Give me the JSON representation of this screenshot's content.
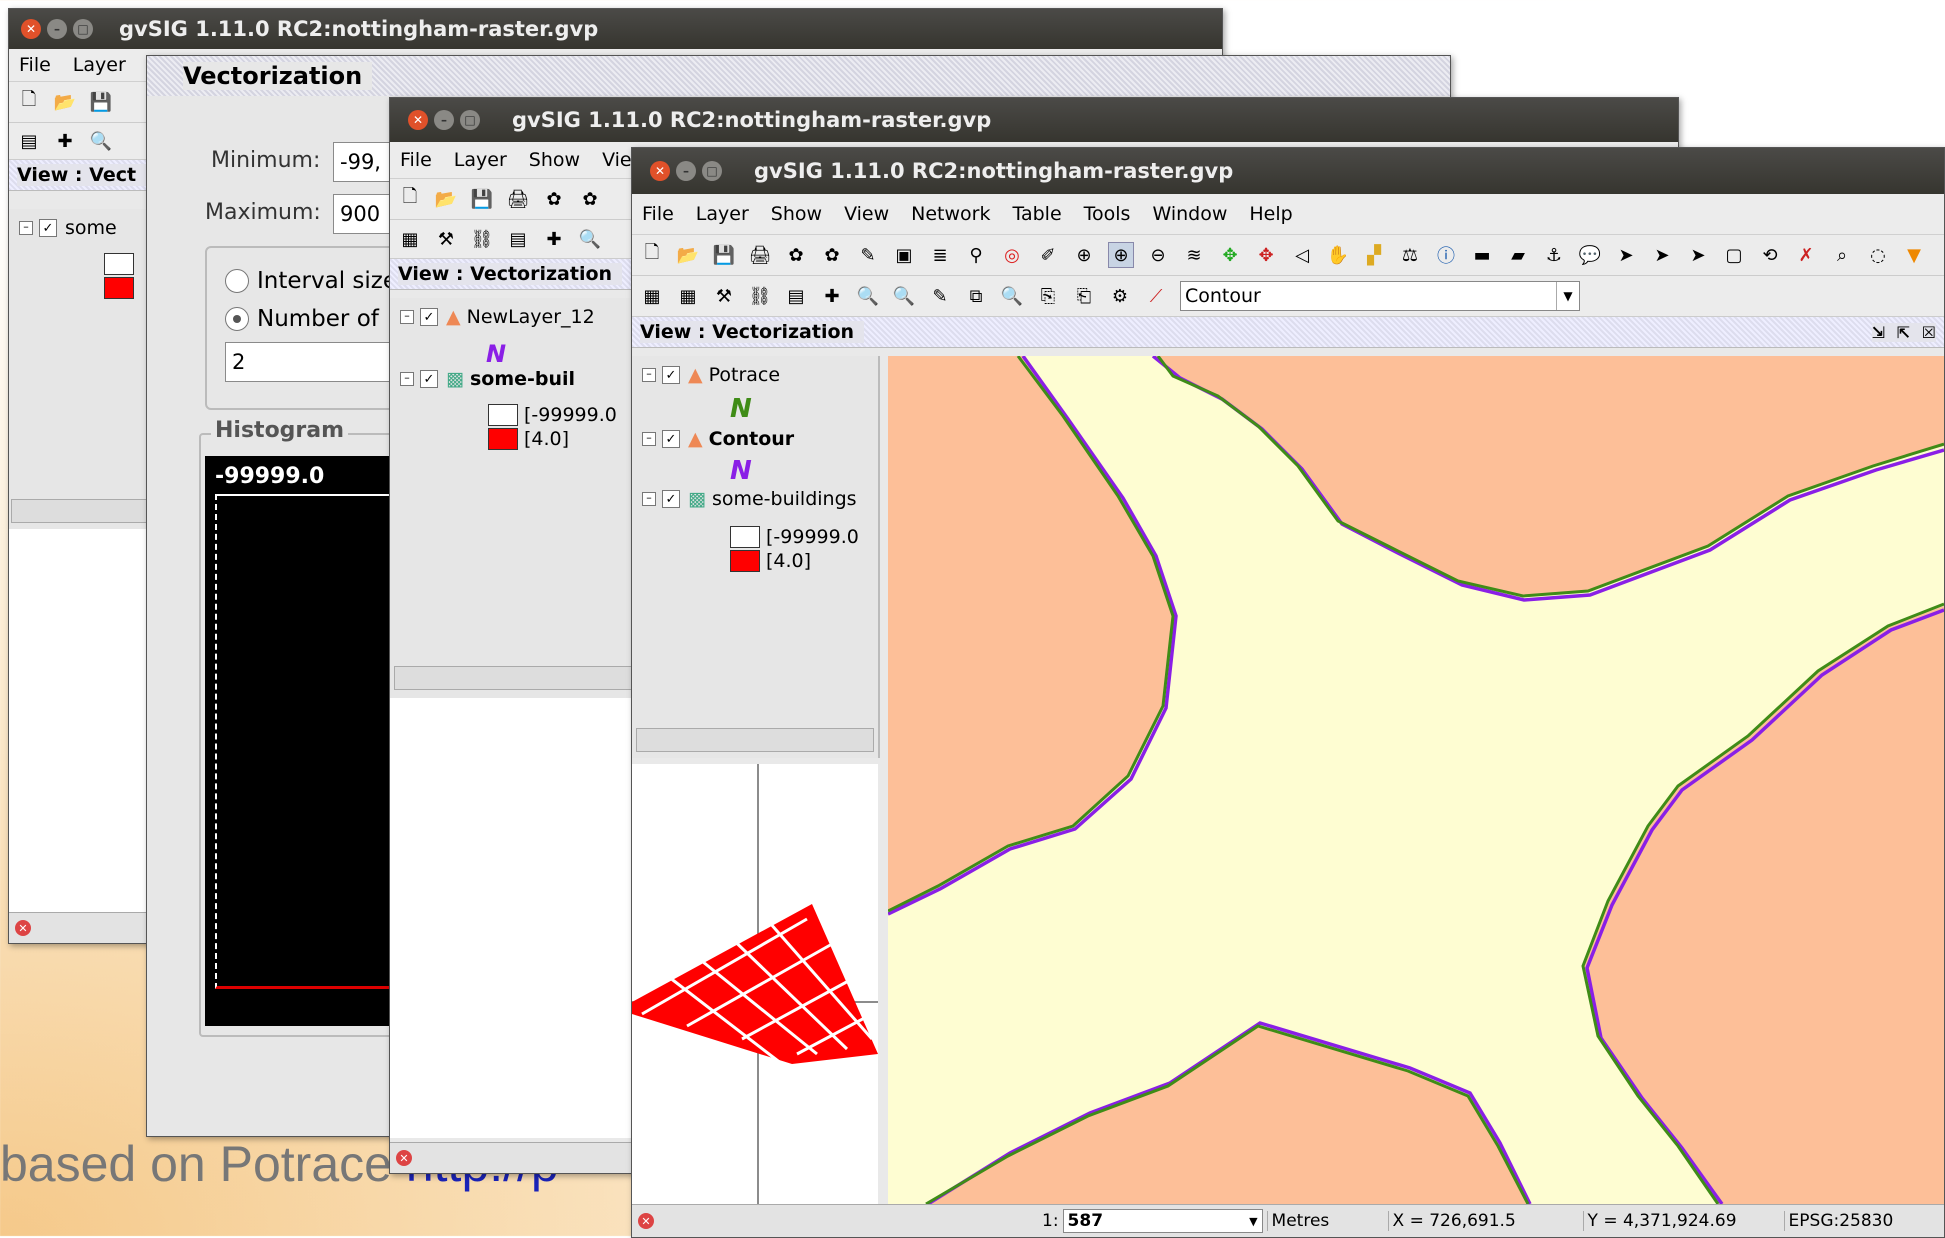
{
  "background_text": {
    "prefix": "based on Potrace",
    "link": "http://p"
  },
  "win1": {
    "title": "gvSIG 1.11.0 RC2:nottingham-raster.gvp",
    "menu": [
      "File",
      "Layer"
    ],
    "view_title": "View : Vect",
    "layer": "some",
    "legend": [
      "[",
      "["
    ]
  },
  "dialog": {
    "title": "Vectorization",
    "minimum_label": "Minimum:",
    "minimum_value": "-99,",
    "maximum_label": "Maximum:",
    "maximum_value": "900",
    "interval_label": "Interval size",
    "number_label": "Number of",
    "number_value": "2",
    "histogram_label": "Histogram",
    "histogram_value": "-99999.0"
  },
  "win2": {
    "title": "gvSIG 1.11.0 RC2:nottingham-raster.gvp",
    "menu": [
      "File",
      "Layer",
      "Show",
      "Vie"
    ],
    "view_title": "View : Vectorization",
    "layers": [
      "NewLayer_12",
      "some-buil"
    ],
    "legend": [
      "[-99999.0",
      "[4.0]"
    ]
  },
  "win3": {
    "title": "gvSIG 1.11.0 RC2:nottingham-raster.gvp",
    "menu": [
      "File",
      "Layer",
      "Show",
      "View",
      "Network",
      "Table",
      "Tools",
      "Window",
      "Help"
    ],
    "combo_value": "Contour",
    "view_title": "View : Vectorization",
    "layers": [
      "Potrace",
      "Contour",
      "some-buildings"
    ],
    "legend": [
      "[-99999.0",
      "[4.0]"
    ],
    "status": {
      "scale_prefix": "1:",
      "scale_value": "587",
      "units": "Metres",
      "x": "X = 726,691.5",
      "y": "Y = 4,371,924.69",
      "epsg": "EPSG:25830"
    }
  },
  "colors": {
    "land": "#fdbf98",
    "road": "#fefdd2",
    "contour_green": "#3f8c17",
    "potrace_purple": "#8a1fe6",
    "building_red": "#ff0000"
  }
}
